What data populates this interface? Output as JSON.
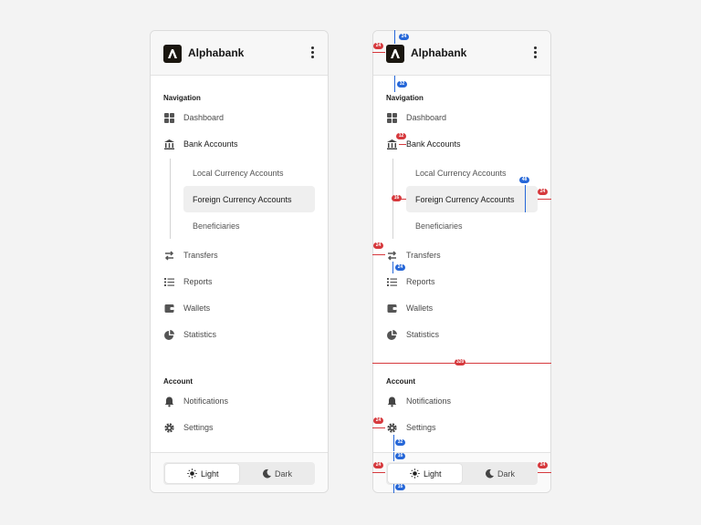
{
  "app": {
    "brand": "Alphabank",
    "menu_icon": "kebab-menu-icon",
    "logo_icon": "alphabank-logo-icon"
  },
  "navigation": {
    "label": "Navigation",
    "items": [
      {
        "label": "Dashboard",
        "icon": "grid-icon"
      },
      {
        "label": "Bank Accounts",
        "icon": "bank-icon",
        "expanded": true,
        "children": [
          {
            "label": "Local Currency Accounts"
          },
          {
            "label": "Foreign Currency Accounts",
            "selected": true
          },
          {
            "label": "Beneficiaries"
          }
        ]
      },
      {
        "label": "Transfers",
        "icon": "transfer-arrows-icon"
      },
      {
        "label": "Reports",
        "icon": "list-icon"
      },
      {
        "label": "Wallets",
        "icon": "wallet-icon"
      },
      {
        "label": "Statistics",
        "icon": "pie-chart-icon"
      }
    ]
  },
  "account": {
    "label": "Account",
    "items": [
      {
        "label": "Notifications",
        "icon": "bell-icon"
      },
      {
        "label": "Settings",
        "icon": "gear-icon"
      }
    ]
  },
  "theme_toggle": {
    "light_label": "Light",
    "dark_label": "Dark",
    "selected": "Light"
  },
  "measurements": {
    "header_top": "24",
    "header_left": "24",
    "nav_gap": "32",
    "icon_gap": "12",
    "sub_indent": "16",
    "item_height": "48",
    "right_margin": "24",
    "side_margin": "24",
    "item_gap": "24",
    "panel_width": "320",
    "settings_left": "24",
    "footer_gap": "32",
    "footer_pad": "16",
    "toggle_left": "24",
    "toggle_right": "24",
    "footer_bottom": "16"
  },
  "colors": {
    "background": "#f3f3f3",
    "panel": "#ffffff",
    "selected_item": "#efefef",
    "logo": "#1a160f",
    "annotation_red": "#d6393d",
    "annotation_blue": "#2667d8"
  }
}
